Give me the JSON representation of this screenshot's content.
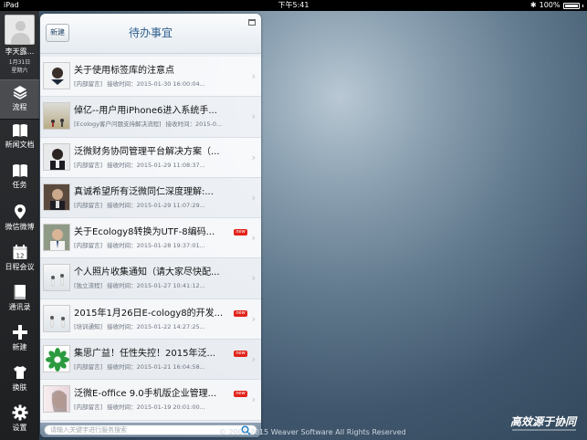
{
  "status_bar": {
    "device": "iPad",
    "time": "下午5:41",
    "battery": "100%"
  },
  "user": {
    "name": "李天露...",
    "date": "1月31日",
    "weekday": "星期六"
  },
  "nav": [
    {
      "label": "流程",
      "icon": "layers-icon",
      "active": true
    },
    {
      "label": "新闻文档",
      "icon": "book-icon"
    },
    {
      "label": "任务",
      "icon": "book-icon"
    },
    {
      "label": "微信微博",
      "icon": "location-pin-icon"
    },
    {
      "label": "日程会议",
      "icon": "calendar-icon"
    },
    {
      "label": "通讯录",
      "icon": "contacts-icon"
    },
    {
      "label": "新建",
      "icon": "plus-icon"
    },
    {
      "label": "换肤",
      "icon": "shirt-icon"
    },
    {
      "label": "设置",
      "icon": "gear-icon"
    }
  ],
  "calendar_day": "12",
  "panel": {
    "new_label": "新建",
    "title": "待办事宜"
  },
  "todos": [
    {
      "title": "关于使用标签库的注意点",
      "source": "[内部留言]",
      "received": "接收时间：2015-01-30 16:00:04...",
      "is_new": false
    },
    {
      "title": "倬亿--用户用iPhone6进入系统手...",
      "source": "[Ecology客户问题支持解决流程]",
      "received": "接收时间：2015-0...",
      "is_new": false
    },
    {
      "title": "泛微财务协同管理平台解决方案（...",
      "source": "[内部留言]",
      "received": "接收时间：2015-01-29 11:08:37...",
      "is_new": false
    },
    {
      "title": "真诚希望所有泛微同仁深度理解:...",
      "source": "[内部留言]",
      "received": "接收时间：2015-01-29 11:07:29...",
      "is_new": false
    },
    {
      "title": "关于Ecology8转换为UTF-8编码...",
      "source": "[内部留言]",
      "received": "接收时间：2015-01-28 19:37:01...",
      "is_new": true
    },
    {
      "title": "个人照片收集通知（请大家尽快配...",
      "source": "[独立流程]",
      "received": "接收时间：2015-01-27 10:41:12...",
      "is_new": false
    },
    {
      "title": "2015年1月26日E-cology8的开发...",
      "source": "[培训通知]",
      "received": "接收时间：2015-01-22 14:27:25...",
      "is_new": true
    },
    {
      "title": "集思广益！任性失控！2015年泛...",
      "source": "[内部留言]",
      "received": "接收时间：2015-01-21 16:04:58...",
      "is_new": true
    },
    {
      "title": "泛微E-office 9.0手机版企业管理...",
      "source": "[内部留言]",
      "received": "接收时间：2015-01-19 20:01:00...",
      "is_new": true
    }
  ],
  "new_badge": "new",
  "search": {
    "placeholder": "请输入关键字进行服务搜索"
  },
  "footer": {
    "copyright": "© 2001-2015 Weaver Software All Rights Reserved",
    "slogan": "高效源于协同"
  },
  "colors": {
    "accent": "#2f5f8e",
    "badge": "#e2231a",
    "sidebar": "#262729"
  }
}
